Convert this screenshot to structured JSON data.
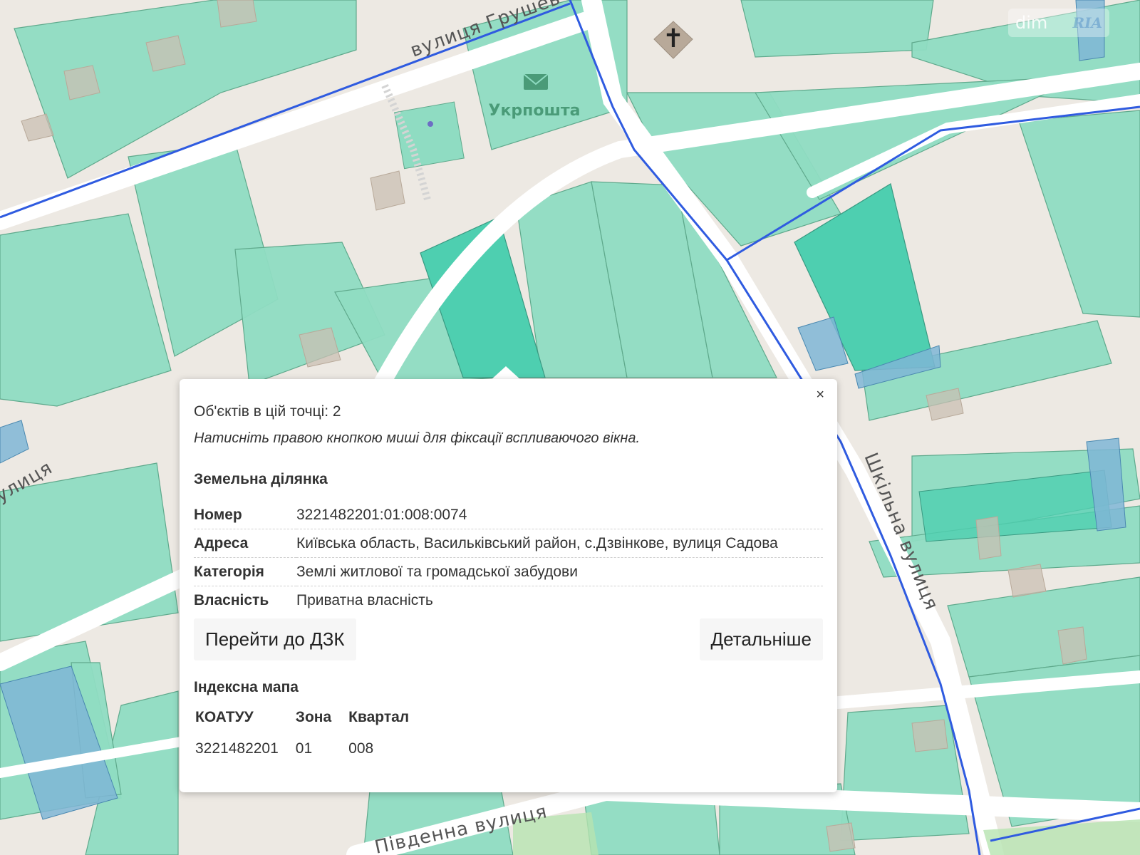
{
  "map": {
    "streets": {
      "hrushevskoho": "вулиця Грушев",
      "shkilna": "Шкільна вулиця",
      "pivdenna": "Південна вулиця",
      "left_fragment": "улиця"
    },
    "poi": {
      "post_office": "Укрпошта",
      "post_office_icon": "envelope-icon",
      "church_icon": "cross-icon"
    },
    "colors": {
      "background": "#ede9e3",
      "parcel": "#8fdcc2",
      "parcel_selected": "#4ecfb0",
      "boundary": "#2f5be0",
      "blue_parcel": "#7fb6d6"
    }
  },
  "watermark": {
    "text": "dim",
    "logo": "RIA"
  },
  "popup": {
    "close_label": "×",
    "count_line": "Об'єктів в цій точці: 2",
    "hint": "Натисніть правою кнопкою миші для фіксації вспливаючого вікна.",
    "parcel": {
      "title": "Земельна ділянка",
      "rows": [
        {
          "label": "Номер",
          "value": "3221482201:01:008:0074"
        },
        {
          "label": "Адреса",
          "value": "Київська область, Васильківський район, с.Дзвінкове, вулиця Садова"
        },
        {
          "label": "Категорія",
          "value": "Землі житлової та громадської забудови"
        },
        {
          "label": "Власність",
          "value": "Приватна власність"
        }
      ]
    },
    "buttons": {
      "goto_dzk": "Перейти до ДЗК",
      "details": "Детальніше"
    },
    "index_map": {
      "title": "Індексна мапа",
      "headers": [
        "КОАТУУ",
        "Зона",
        "Квартал"
      ],
      "values": [
        "3221482201",
        "01",
        "008"
      ]
    }
  }
}
